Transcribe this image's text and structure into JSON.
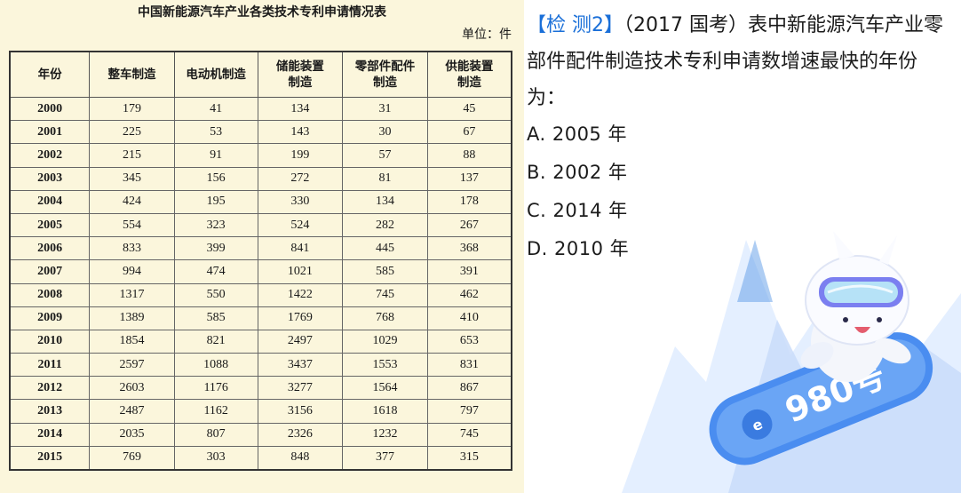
{
  "table": {
    "title": "中国新能源汽车产业各类技术专利申请情况表",
    "unit": "单位：件",
    "headers": [
      "年份",
      "整车制造",
      "电动机制造",
      "储能装置\n制造",
      "零部件配件\n制造",
      "供能装置\n制造"
    ],
    "rows": [
      [
        "2000",
        "179",
        "41",
        "134",
        "31",
        "45"
      ],
      [
        "2001",
        "225",
        "53",
        "143",
        "30",
        "67"
      ],
      [
        "2002",
        "215",
        "91",
        "199",
        "57",
        "88"
      ],
      [
        "2003",
        "345",
        "156",
        "272",
        "81",
        "137"
      ],
      [
        "2004",
        "424",
        "195",
        "330",
        "134",
        "178"
      ],
      [
        "2005",
        "554",
        "323",
        "524",
        "282",
        "267"
      ],
      [
        "2006",
        "833",
        "399",
        "841",
        "445",
        "368"
      ],
      [
        "2007",
        "994",
        "474",
        "1021",
        "585",
        "391"
      ],
      [
        "2008",
        "1317",
        "550",
        "1422",
        "745",
        "462"
      ],
      [
        "2009",
        "1389",
        "585",
        "1769",
        "768",
        "410"
      ],
      [
        "2010",
        "1854",
        "821",
        "2497",
        "1029",
        "653"
      ],
      [
        "2011",
        "2597",
        "1088",
        "3437",
        "1553",
        "831"
      ],
      [
        "2012",
        "2603",
        "1176",
        "3277",
        "1564",
        "867"
      ],
      [
        "2013",
        "2487",
        "1162",
        "3156",
        "1618",
        "797"
      ],
      [
        "2014",
        "2035",
        "807",
        "2326",
        "1232",
        "745"
      ],
      [
        "2015",
        "769",
        "303",
        "848",
        "377",
        "315"
      ]
    ]
  },
  "question": {
    "tag": "【检 测2】",
    "text": "（2017 国考）表中新能源汽车产业零部件配件制造技术专利申请数增速最快的年份为：",
    "options": [
      "A.  2005 年",
      "B. 2002 年",
      "C. 2014 年",
      "D. 2010 年"
    ]
  },
  "mascot": {
    "board_text": "980号",
    "colors": {
      "accent": "#4a8df0",
      "sky": "#cfe3fb",
      "goggle": "#7b7ff0"
    }
  }
}
